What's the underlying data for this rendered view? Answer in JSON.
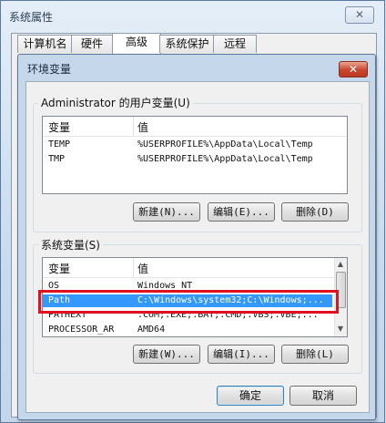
{
  "outer_dialog": {
    "title": "系统属性",
    "close_glyph": "✕",
    "tabs": [
      {
        "label": "计算机名",
        "active": false
      },
      {
        "label": "硬件",
        "active": false
      },
      {
        "label": "高级",
        "active": true
      },
      {
        "label": "系统保护",
        "active": false
      },
      {
        "label": "远程",
        "active": false
      }
    ]
  },
  "env_dialog": {
    "title": "环境变量",
    "close_glyph": "✕",
    "user_vars": {
      "group_label": "Administrator 的用户变量(U)",
      "columns": [
        "变量",
        "值"
      ],
      "rows": [
        {
          "name": "TEMP",
          "value": "%USERPROFILE%\\AppData\\Local\\Temp"
        },
        {
          "name": "TMP",
          "value": "%USERPROFILE%\\AppData\\Local\\Temp"
        }
      ],
      "buttons": {
        "new": "新建(N)...",
        "edit": "编辑(E)...",
        "delete": "删除(D)"
      }
    },
    "system_vars": {
      "group_label": "系统变量(S)",
      "columns": [
        "变量",
        "值"
      ],
      "rows": [
        {
          "name": "OS",
          "value": "Windows_NT",
          "selected": false
        },
        {
          "name": "Path",
          "value": "C:\\Windows\\system32;C:\\Windows;...",
          "selected": true
        },
        {
          "name": "PATHEXT",
          "value": ".COM;.EXE;.BAT;.CMD;.VBS;.VBE;...",
          "selected": false
        },
        {
          "name": "PROCESSOR_AR",
          "value": "AMD64",
          "selected": false
        }
      ],
      "buttons": {
        "new": "新建(W)...",
        "edit": "编辑(I)...",
        "delete": "删除(L)"
      }
    },
    "ok_label": "确定",
    "cancel_label": "取消"
  },
  "colors": {
    "selection": "#3399ff",
    "highlight_box": "#e0121f",
    "close_button": "#c9452d"
  }
}
